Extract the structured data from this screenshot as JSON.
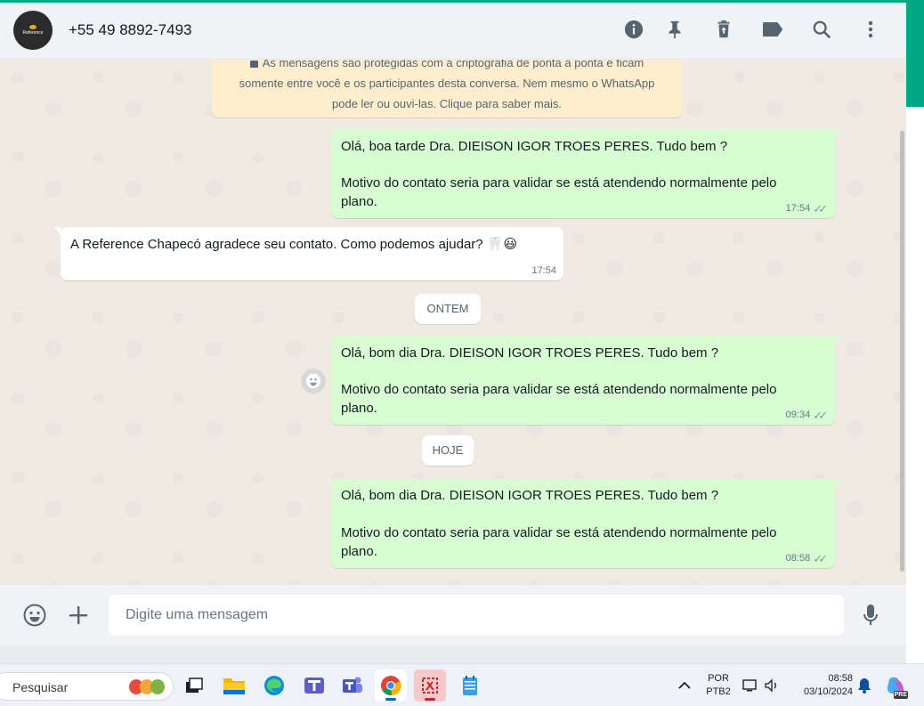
{
  "header": {
    "contact_name": "+55 49 8892-7493",
    "avatar_text": "Reference",
    "icons": [
      "info-icon",
      "pin-icon",
      "delete-icon",
      "label-icon",
      "search-icon",
      "menu-icon"
    ]
  },
  "chat": {
    "encryption_notice": {
      "line1": "As mensagens são protegidas com a criptografia de ponta a ponta e ficam",
      "line2": "somente entre você e os participantes desta conversa. Nem mesmo o WhatsApp",
      "line3": "pode ler ou ouvi-las. Clique para saber mais."
    },
    "messages": [
      {
        "direction": "out",
        "line1": "Olá, boa tarde Dra. DIEISON IGOR TROES PERES. Tudo bem ?",
        "line2": "Motivo do contato seria para validar se está atendendo normalmente pelo plano.",
        "time": "17:54",
        "status": "read"
      },
      {
        "direction": "in",
        "text": "A Reference Chapecó agradece seu contato. Como podemos ajudar? 🦷😃",
        "time": "17:54"
      },
      {
        "direction": "out",
        "line1": "Olá, bom dia Dra. DIEISON IGOR TROES PERES. Tudo bem ?",
        "line2": "Motivo do contato seria para validar se está atendendo normalmente pelo plano.",
        "time": "09:34",
        "status": "read"
      },
      {
        "direction": "out",
        "line1": "Olá, bom dia Dra. DIEISON IGOR TROES PERES. Tudo bem ?",
        "line2": "Motivo do contato seria para validar se está atendendo normalmente pelo plano.",
        "time": "08:58",
        "status": "read"
      }
    ],
    "date_chips": [
      "ONTEM",
      "HOJE"
    ],
    "ticks_glyph": "✓✓"
  },
  "composer": {
    "placeholder": "Digite uma mensagem"
  },
  "taskbar": {
    "search_label": "Pesquisar",
    "apps": [
      "task-view",
      "file-explorer",
      "edge",
      "teams-classroom",
      "teams",
      "chrome",
      "snipping-tool",
      "notepad"
    ],
    "language_line1": "POR",
    "language_line2": "PTB2",
    "time": "08:58",
    "date": "03/10/2024",
    "copilot_badge": "PRE"
  },
  "colors": {
    "accent": "#00a884",
    "outgoing_bubble": "#d9fdd3",
    "incoming_bubble": "#ffffff",
    "chat_background": "#efeae2",
    "notice_background": "#ffeecd"
  }
}
